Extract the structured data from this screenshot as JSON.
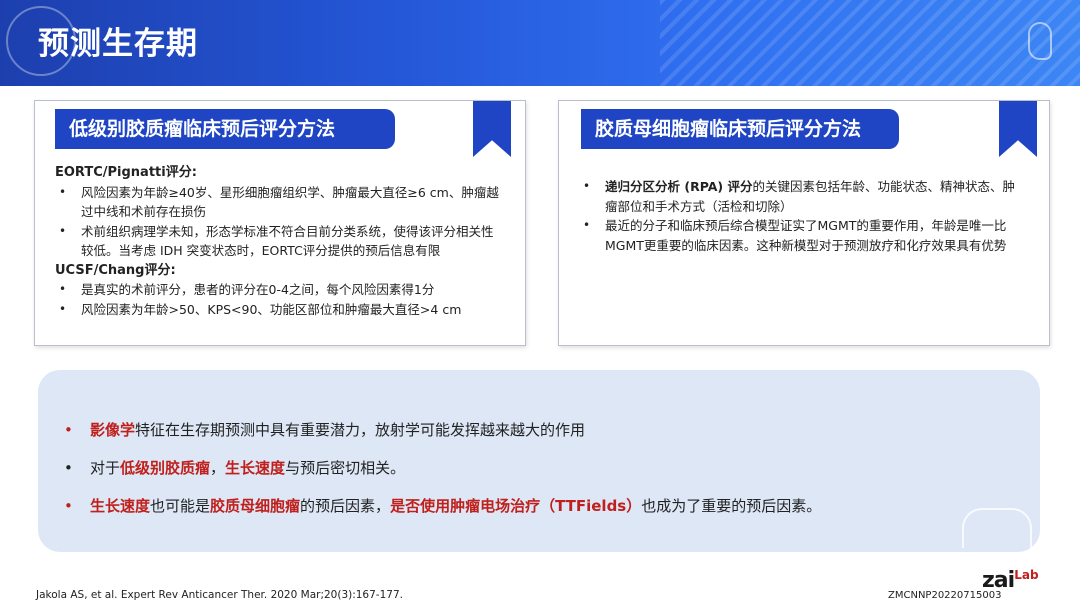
{
  "header": {
    "title": "预测生存期"
  },
  "left_card": {
    "title": "低级别胶质瘤临床预后评分方法",
    "sections": [
      {
        "heading": "EORTC/Pignatti评分:",
        "items": [
          "风险因素为年龄≥40岁、星形细胞瘤组织学、肿瘤最大直径≥6 cm、肿瘤越过中线和术前存在损伤",
          "术前组织病理学未知，形态学标准不符合目前分类系统，使得该评分相关性较低。当考虑 IDH 突变状态时，EORTC评分提供的预后信息有限"
        ]
      },
      {
        "heading": "UCSF/Chang评分:",
        "items": [
          "是真实的术前评分，患者的评分在0-4之间，每个风险因素得1分",
          "风险因素为年龄>50、KPS<90、功能区部位和肿瘤最大直径>4 cm"
        ]
      }
    ]
  },
  "right_card": {
    "title": "胶质母细胞瘤临床预后评分方法",
    "items": [
      {
        "bold": "递归分区分析 (RPA) 评分",
        "text": "的关键因素包括年龄、功能状态、精神状态、肿瘤部位和手术方式（活检和切除）"
      },
      {
        "bold": "",
        "text": "最近的分子和临床预后综合模型证实了MGMT的重要作用，年龄是唯一比MGMT更重要的临床因素。这种新模型对于预测放疗和化疗效果具有优势"
      }
    ]
  },
  "summary": {
    "items": [
      {
        "bullet": "red",
        "parts": [
          {
            "t": "影像学",
            "hl": true
          },
          {
            "t": "特征在生存期预测中具有重要潜力，放射学可能发挥越来越大的作用",
            "hl": false
          }
        ]
      },
      {
        "bullet": "black",
        "parts": [
          {
            "t": "对于",
            "hl": false
          },
          {
            "t": "低级别胶质瘤",
            "hl": true
          },
          {
            "t": "，",
            "hl": false
          },
          {
            "t": "生长速度",
            "hl": true
          },
          {
            "t": "与预后密切相关。",
            "hl": false
          }
        ]
      },
      {
        "bullet": "red",
        "parts": [
          {
            "t": "生长速度",
            "hl": true
          },
          {
            "t": "也可能是",
            "hl": false
          },
          {
            "t": "胶质母细胞瘤",
            "hl": true
          },
          {
            "t": "的预后因素，",
            "hl": false
          },
          {
            "t": "是否使用肿瘤电场治疗（TTFields）",
            "hl": true
          },
          {
            "t": "也成为了重要的预后因素。",
            "hl": false
          }
        ]
      }
    ]
  },
  "footer": {
    "citation": "Jakola AS, et al. Expert Rev Anticancer Ther. 2020 Mar;20(3):167-177.",
    "code": "ZMCNNP20220715003",
    "logo_main": "zai",
    "logo_lab": "Lab"
  },
  "colors": {
    "brand_blue": "#1f45c4",
    "highlight_red": "#c0201c",
    "summary_bg": "#dde7f6"
  }
}
